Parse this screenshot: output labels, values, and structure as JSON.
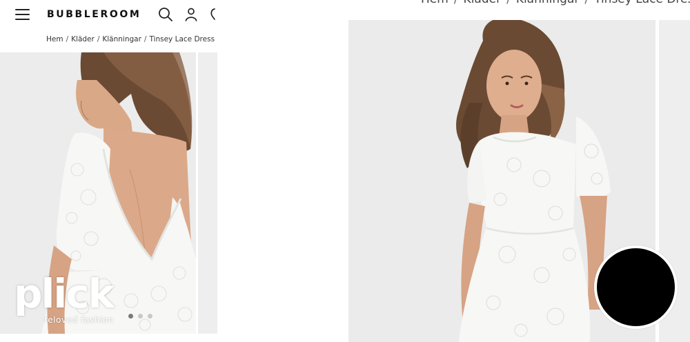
{
  "header": {
    "brand": "BUBBLEROOM"
  },
  "icons": {
    "menu": "hamburger-menu-icon",
    "search": "search-icon",
    "account": "account-icon",
    "bag": "shopping-bag-icon"
  },
  "breadcrumb": {
    "items": [
      "Hem",
      "Kläder",
      "Klänningar",
      "Tinsey Lace Dress"
    ],
    "separator": "/"
  },
  "gallery": {
    "slide_count": 3,
    "active_slide": 1
  },
  "watermark": {
    "word": "plick",
    "tagline": "reloved fashion"
  },
  "colors": {
    "background": "#ffffff",
    "text": "#222222",
    "photo_background": "#ebebeb",
    "dress": "#f7f7f5",
    "hair": "#6b4a33",
    "overlay_circle": "#000000"
  }
}
